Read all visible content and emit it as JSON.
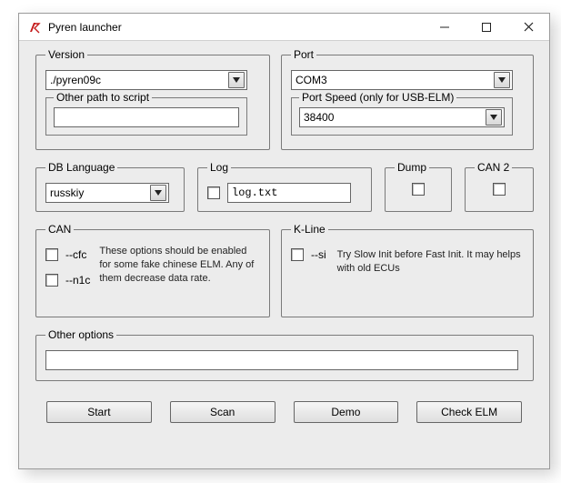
{
  "window": {
    "title": "Pyren launcher"
  },
  "version": {
    "legend": "Version",
    "value": "./pyren09c",
    "other_path_label": "Other path to script",
    "other_path_value": ""
  },
  "port": {
    "legend": "Port",
    "value": "COM3",
    "speed_label": "Port Speed (only for USB-ELM)",
    "speed_value": "38400"
  },
  "dblang": {
    "legend": "DB Language",
    "value": "russkiy"
  },
  "log": {
    "legend": "Log",
    "checked": false,
    "value": "log.txt"
  },
  "dump": {
    "legend": "Dump",
    "checked": false
  },
  "can2": {
    "legend": "CAN 2",
    "checked": false
  },
  "can": {
    "legend": "CAN",
    "opt1_label": "--cfc",
    "opt1_checked": false,
    "opt2_label": "--n1c",
    "opt2_checked": false,
    "hint": "These options should be enabled for some fake chinese ELM. Any of them decrease data rate."
  },
  "kline": {
    "legend": "K-Line",
    "opt_label": "--si",
    "opt_checked": false,
    "hint": "Try Slow Init before Fast Init. It may helps with old ECUs"
  },
  "other": {
    "legend": "Other options",
    "value": ""
  },
  "buttons": {
    "start": "Start",
    "scan": "Scan",
    "demo": "Demo",
    "check": "Check ELM"
  }
}
